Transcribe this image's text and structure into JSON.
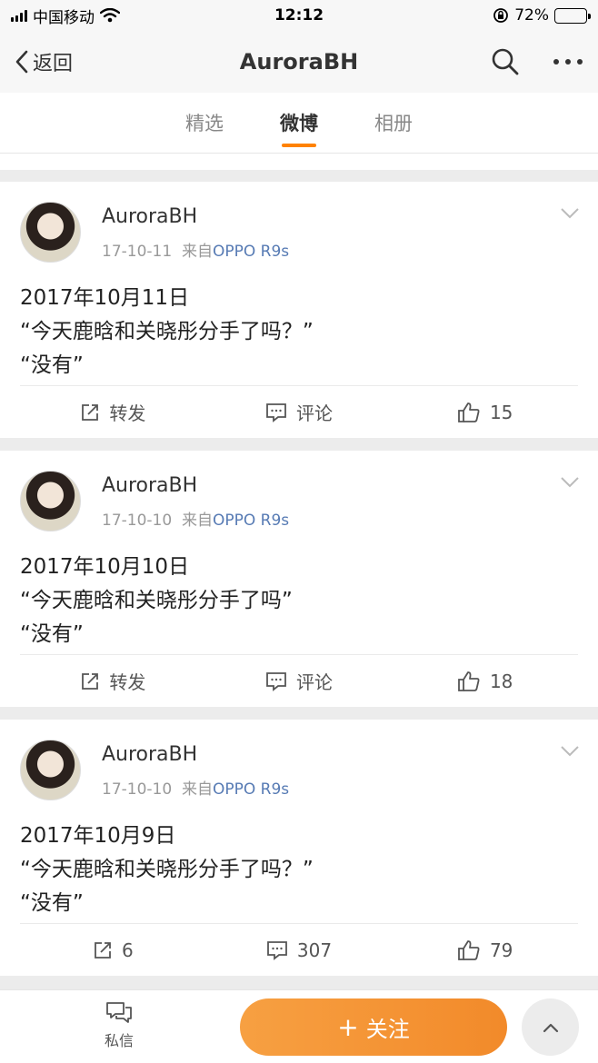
{
  "status_bar": {
    "carrier": "中国移动",
    "time": "12:12",
    "battery_percent": "72%",
    "battery_level": 0.72,
    "battery_color": "#f4c431"
  },
  "nav": {
    "back_label": "返回",
    "title": "AuroraBH",
    "search_icon": "search-icon",
    "more_icon": "more-icon"
  },
  "tabs": [
    {
      "label": "精选",
      "active": false
    },
    {
      "label": "微博",
      "active": true
    },
    {
      "label": "相册",
      "active": false
    }
  ],
  "accent_color": "#ff8200",
  "posts": [
    {
      "author": "AuroraBH",
      "date": "17-10-11",
      "source_prefix": "来自",
      "device": "OPPO R9s",
      "text": "2017年10月11日\n“今天鹿晗和关晓彤分手了吗？”\n“没有”",
      "repost": "转发",
      "comment": "评论",
      "likes": "15"
    },
    {
      "author": "AuroraBH",
      "date": "17-10-10",
      "source_prefix": "来自",
      "device": "OPPO R9s",
      "text": "2017年10月10日\n“今天鹿晗和关晓彤分手了吗”\n“没有”",
      "repost": "转发",
      "comment": "评论",
      "likes": "18"
    },
    {
      "author": "AuroraBH",
      "date": "17-10-10",
      "source_prefix": "来自",
      "device": "OPPO R9s",
      "text": "2017年10月9日\n“今天鹿晗和关晓彤分手了吗？”\n“没有”",
      "repost": "6",
      "comment": "307",
      "likes": "79"
    }
  ],
  "bottom": {
    "dm_label": "私信",
    "follow_label": "关注",
    "follow_plus": "+",
    "up_icon": "chevron-up-icon"
  }
}
